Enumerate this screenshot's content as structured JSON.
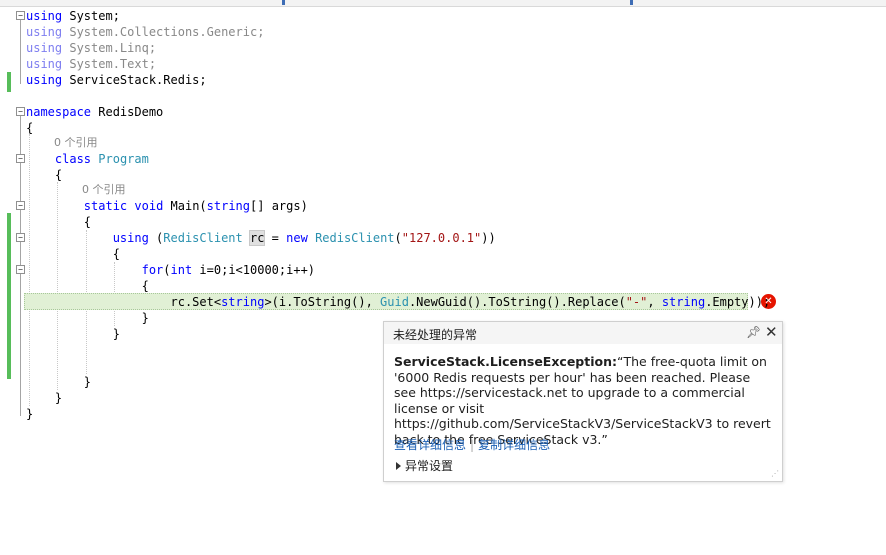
{
  "code_lines": [
    {
      "id": "l1",
      "parts": [
        {
          "t": "using",
          "c": "kw"
        },
        {
          "t": " System;"
        }
      ]
    },
    {
      "id": "l2",
      "parts": [
        {
          "t": "using",
          "c": "kw-faded"
        },
        {
          "t": " System.Collections.Generic;",
          "c": "gray"
        }
      ]
    },
    {
      "id": "l3",
      "parts": [
        {
          "t": "using",
          "c": "kw-faded"
        },
        {
          "t": " System.Linq;",
          "c": "gray"
        }
      ]
    },
    {
      "id": "l4",
      "parts": [
        {
          "t": "using",
          "c": "kw-faded"
        },
        {
          "t": " System.Text;",
          "c": "gray"
        }
      ]
    },
    {
      "id": "l5",
      "parts": [
        {
          "t": "using",
          "c": "kw"
        },
        {
          "t": " ServiceStack.Redis;"
        }
      ]
    },
    {
      "id": "l6",
      "parts": []
    },
    {
      "id": "l7",
      "parts": [
        {
          "t": "namespace",
          "c": "kw"
        },
        {
          "t": " RedisDemo"
        }
      ]
    },
    {
      "id": "l8",
      "parts": [
        {
          "t": "{"
        }
      ]
    },
    {
      "id": "l9",
      "ref": "0 个引用",
      "parts": [
        {
          "t": "    class",
          "c": "kw"
        },
        {
          "t": " "
        },
        {
          "t": "Program",
          "c": "type"
        }
      ]
    },
    {
      "id": "l10",
      "parts": [
        {
          "t": "    {"
        }
      ]
    },
    {
      "id": "l11",
      "ref": "0 个引用",
      "parts": [
        {
          "t": "        static",
          "c": "kw"
        },
        {
          "t": " "
        },
        {
          "t": "void",
          "c": "kw"
        },
        {
          "t": " Main("
        },
        {
          "t": "string",
          "c": "kw"
        },
        {
          "t": "[] args)"
        }
      ]
    },
    {
      "id": "l12",
      "parts": [
        {
          "t": "        {"
        }
      ]
    },
    {
      "id": "l13",
      "parts": [
        {
          "t": "            using",
          "c": "kw"
        },
        {
          "t": " ("
        },
        {
          "t": "RedisClient",
          "c": "type"
        },
        {
          "t": " "
        },
        {
          "t": "rc",
          "c": "hl-var"
        },
        {
          "t": " = "
        },
        {
          "t": "new",
          "c": "kw"
        },
        {
          "t": " "
        },
        {
          "t": "RedisClient",
          "c": "type"
        },
        {
          "t": "("
        },
        {
          "t": "\"127.0.0.1\"",
          "c": "str"
        },
        {
          "t": "))"
        }
      ]
    },
    {
      "id": "l14",
      "parts": [
        {
          "t": "            {"
        }
      ]
    },
    {
      "id": "l15",
      "parts": [
        {
          "t": "                for",
          "c": "kw"
        },
        {
          "t": "("
        },
        {
          "t": "int",
          "c": "kw"
        },
        {
          "t": " i=0;i<10000;i++)"
        }
      ]
    },
    {
      "id": "l16",
      "parts": [
        {
          "t": "                {"
        }
      ]
    },
    {
      "id": "l17",
      "parts": [
        {
          "t": "                    rc.Set<"
        },
        {
          "t": "string",
          "c": "kw"
        },
        {
          "t": ">(i.ToString(), "
        },
        {
          "t": "Guid",
          "c": "type"
        },
        {
          "t": ".NewGuid().ToString().Replace("
        },
        {
          "t": "\"-\"",
          "c": "str"
        },
        {
          "t": ", "
        },
        {
          "t": "string",
          "c": "kw"
        },
        {
          "t": ".Empty));"
        }
      ]
    },
    {
      "id": "l18",
      "parts": [
        {
          "t": "                }"
        }
      ]
    },
    {
      "id": "l19",
      "parts": [
        {
          "t": "            }"
        }
      ]
    },
    {
      "id": "l20",
      "parts": []
    },
    {
      "id": "l21",
      "parts": []
    },
    {
      "id": "l22",
      "parts": [
        {
          "t": "        }"
        }
      ]
    },
    {
      "id": "l23",
      "parts": [
        {
          "t": "    }"
        }
      ]
    },
    {
      "id": "l24",
      "parts": [
        {
          "t": "}"
        }
      ]
    }
  ],
  "exception_popup": {
    "title": "未经处理的异常",
    "exception_type": "ServiceStack.LicenseException:",
    "message": "“The free-quota limit on '6000 Redis requests per hour' has been reached. Please see https://servicestack.net to upgrade to a commercial license or visit https://github.com/ServiceStackV3/ServiceStackV3 to revert back to the free ServiceStack v3.”",
    "link_view_details": "查看详细信息",
    "link_copy_details": "复制详细信息",
    "settings_label": "异常设置"
  },
  "icons": {
    "error": "error-icon",
    "pin": "pin-icon",
    "close": "close-icon",
    "collapse": "outline-collapse-icon"
  },
  "colors": {
    "keyword": "#0000ff",
    "type": "#2b91af",
    "string": "#a31515",
    "change_bar": "#57bd5a",
    "error": "#e51400",
    "link": "#1a5fb4"
  }
}
